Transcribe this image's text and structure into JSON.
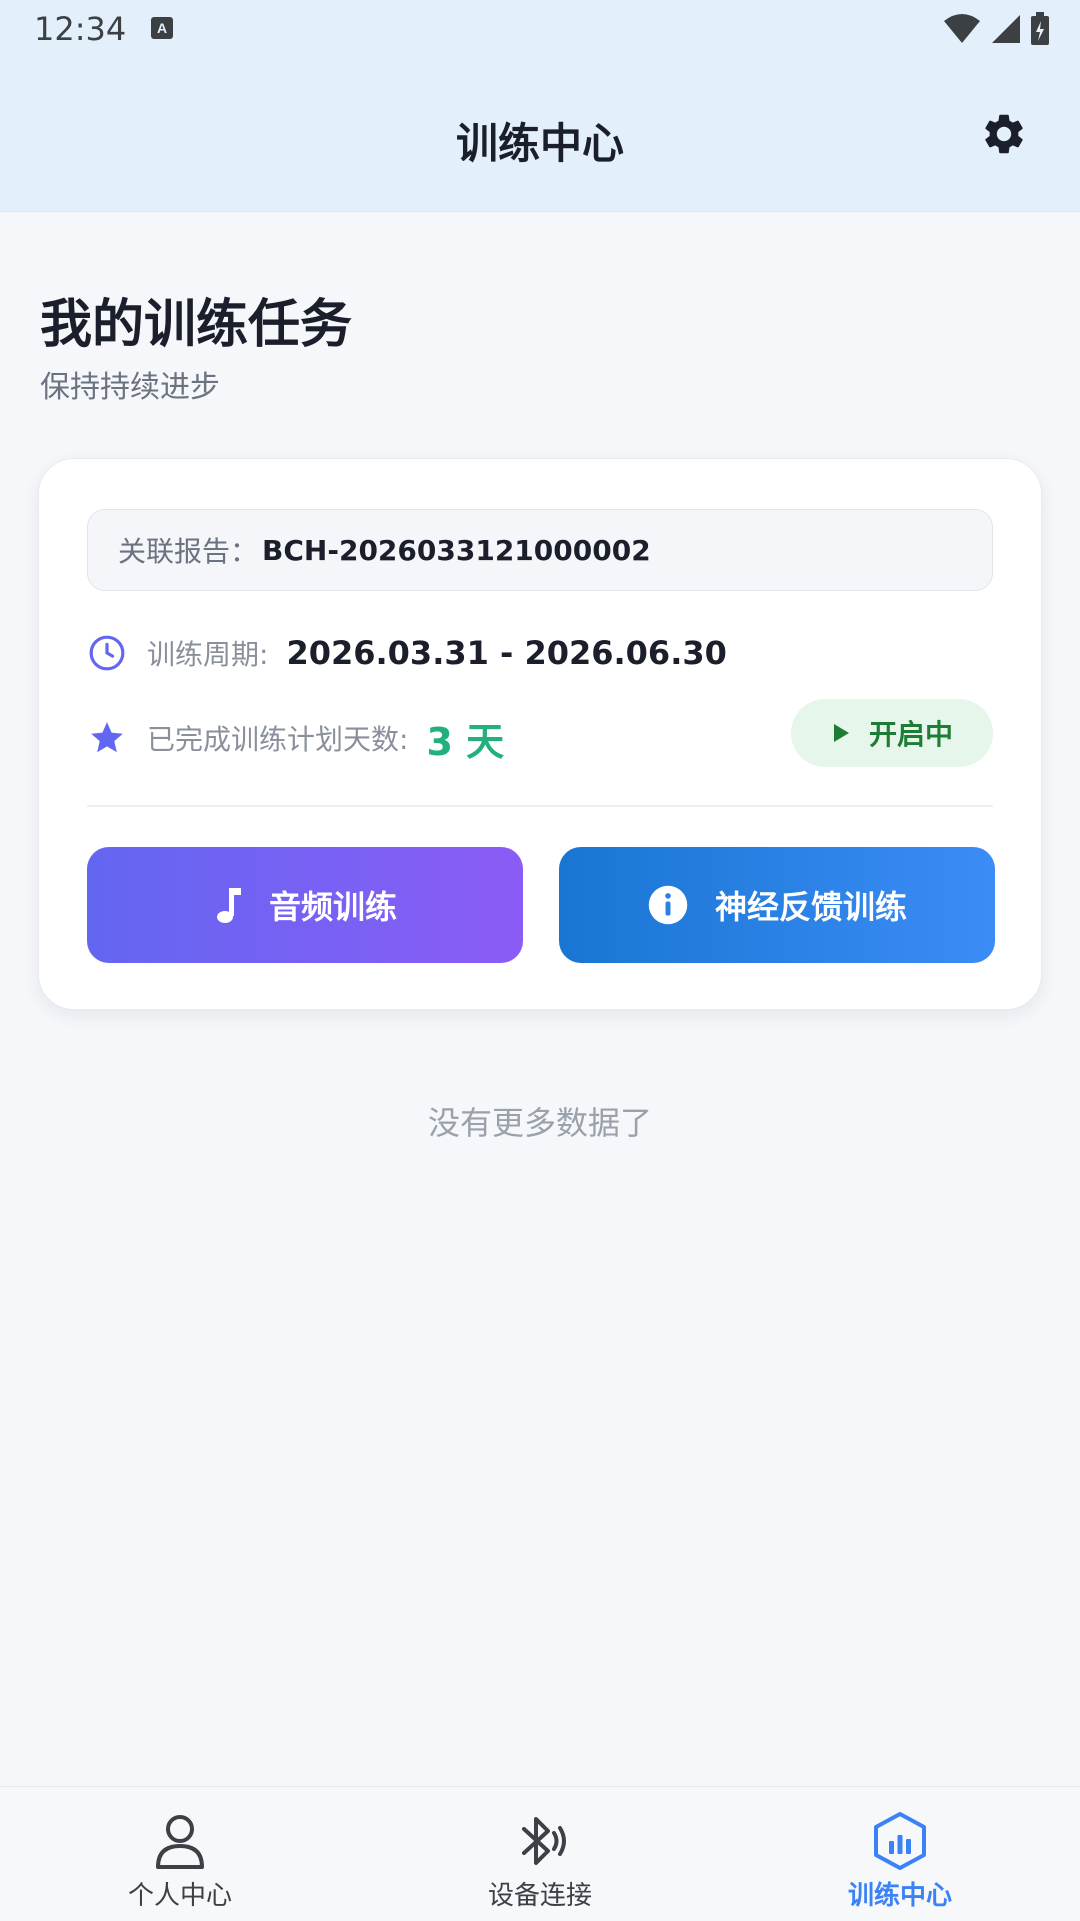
{
  "status_bar": {
    "time": "12:34"
  },
  "header": {
    "title": "训练中心",
    "settings_icon": "gear-icon"
  },
  "page": {
    "title": "我的训练任务",
    "subtitle": "保持持续进步"
  },
  "task": {
    "report_label": "关联报告：",
    "report_id": "BCH-2026033121000002",
    "period_label": "训练周期:",
    "period_value": "2026.03.31 - 2026.06.30",
    "days_label": "已完成训练计划天数:",
    "days_value": "3 天",
    "status_label": "开启中",
    "audio_button": "音频训练",
    "neuro_button": "神经反馈训练"
  },
  "list_end_text": "没有更多数据了",
  "bottom_nav": {
    "items": [
      {
        "label": "个人中心",
        "icon": "person-icon"
      },
      {
        "label": "设备连接",
        "icon": "bluetooth-icon"
      },
      {
        "label": "训练中心",
        "icon": "training-chart-icon",
        "active": true
      }
    ]
  },
  "colors": {
    "accent": "#3b82f6",
    "success": "#22b07d",
    "audio_gradient": [
      "#6366f1",
      "#8b5cf6"
    ],
    "neuro_gradient": [
      "#1976d2",
      "#3b8cf6"
    ]
  }
}
